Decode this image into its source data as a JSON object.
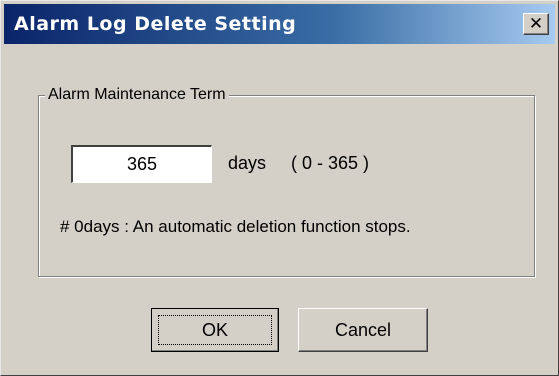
{
  "window": {
    "title": "Alarm Log Delete Setting",
    "close_glyph": "✕",
    "close_icon": "close-icon"
  },
  "group": {
    "label": "Alarm Maintenance Term",
    "days_value": "365",
    "days_unit": "days",
    "range": "( 0 - 365 )",
    "note": "# 0days : An automatic deletion function stops."
  },
  "buttons": {
    "ok_label": "OK",
    "cancel_label": "Cancel"
  },
  "colors": {
    "title_start": "#0a246a",
    "title_end": "#a6caf0",
    "face": "#d4d0c8"
  }
}
